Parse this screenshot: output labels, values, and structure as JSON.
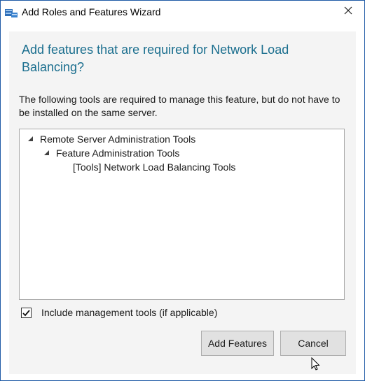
{
  "window": {
    "title": "Add Roles and Features Wizard",
    "icons": {
      "app": "server-manager-icon",
      "close": "close-icon"
    }
  },
  "dialog": {
    "heading": "Add features that are required for Network Load Balancing?",
    "description": "The following tools are required to manage this feature, but do not have to be installed on the same server."
  },
  "tree": {
    "items": [
      {
        "label": "Remote Server Administration Tools",
        "expanded": true
      },
      {
        "label": "Feature Administration Tools",
        "expanded": true
      },
      {
        "label": "[Tools] Network Load Balancing Tools"
      }
    ]
  },
  "options": {
    "include_tools_label": "Include management tools (if applicable)",
    "include_tools_checked": true
  },
  "buttons": {
    "add_features": "Add Features",
    "cancel": "Cancel"
  },
  "colors": {
    "heading": "#1a6e8e",
    "content_bg": "#f4f4f4",
    "button_bg": "#e1e1e1",
    "window_border": "#1f5aa6"
  }
}
